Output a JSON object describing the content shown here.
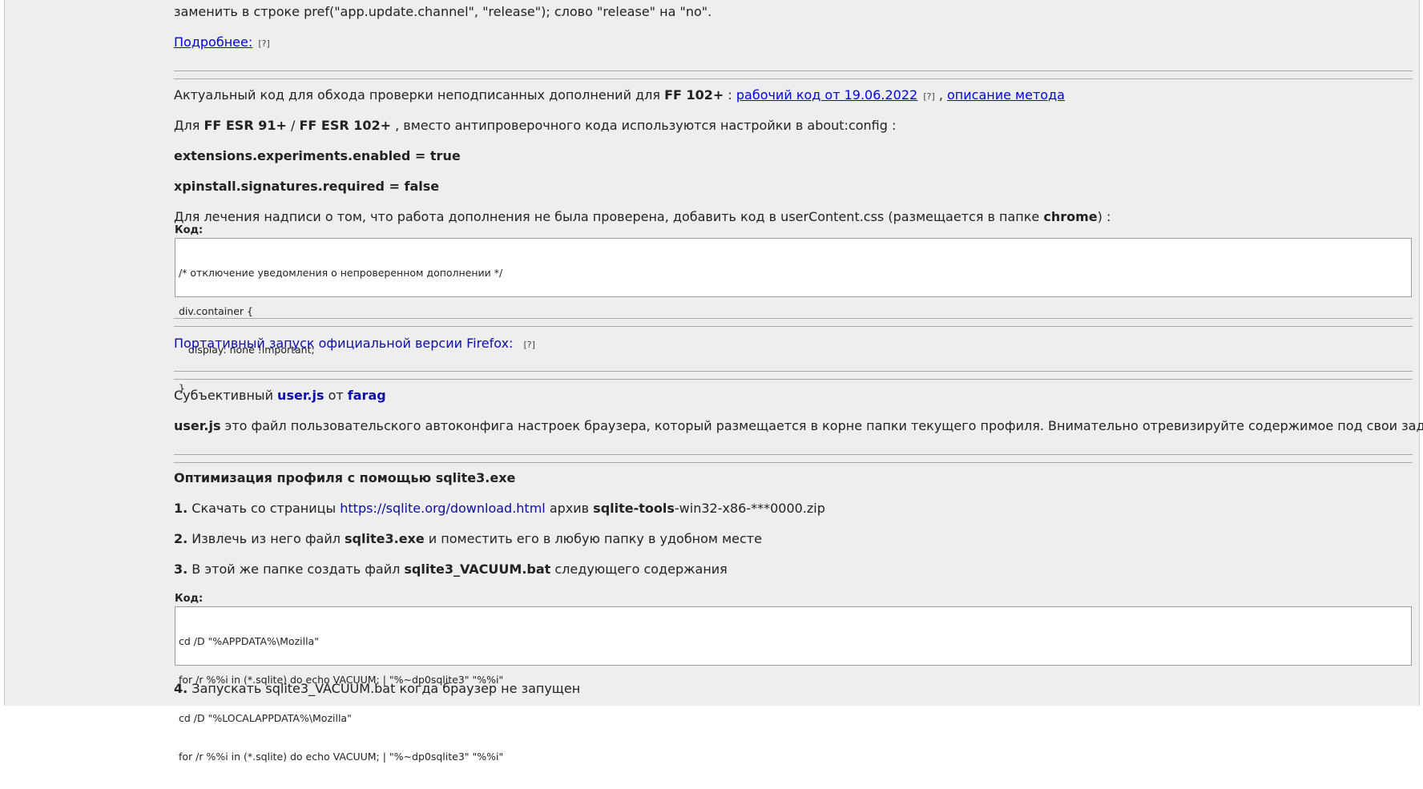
{
  "top_text": "заменить в строке pref(\"app.update.channel\", \"release\"); слово \"release\" на \"no\".",
  "more_link": "Подробнее:",
  "qmark": "[?]",
  "signed": {
    "prefix": "Актуальный код для обхода проверки неподписанных дополнений для ",
    "ff": "FF 102+",
    "colon": " : ",
    "code_link": "рабочий код от 19.06.2022",
    "comma": " , ",
    "method_link": "описание метода"
  },
  "esr": {
    "p1": "Для ",
    "b1": "FF ESR 91+",
    "slash": " / ",
    "b2": "FF ESR 102+",
    "p2": " , вместо антипроверочного кода используются настройки в about:config :"
  },
  "setting1": "extensions.experiments.enabled = true",
  "setting2": "xpinstall.signatures.required = false",
  "cure": {
    "p1": "Для лечения надписи о том, что работа дополнения не была проверена, добавить код в userContent.css (размещается в папке ",
    "b1": "chrome",
    "p2": ") :"
  },
  "code_label": "Код:",
  "code1": [
    "/* отключение уведомления о непроверенном дополнении */",
    "div.container {",
    "   display: none !important;",
    "}"
  ],
  "portable": "Портативный запуск официальной версии Firefox:",
  "userjs": {
    "p1": "Субъективный ",
    "b1": "user.js",
    "p2": " от ",
    "b2": "farag"
  },
  "userjs_desc": {
    "b1": "user.js",
    "p1": " это файл пользовательского автоконфига настроек браузера, который размещается в корне папки текущего профиля. Внимательно отревизируйте содержимое под свои задачи."
  },
  "sqlite_title": "Оптимизация профиля с помощью sqlite3.exe",
  "step1": {
    "n": "1.",
    "p1": " Скачать со страницы ",
    "link": "https://sqlite.org/download.html",
    "p2": " архив ",
    "b1": "sqlite-tools",
    "p3": "-win32-x86-***0000.zip"
  },
  "step2": {
    "n": "2.",
    "p1": " Извлечь из него файл ",
    "b1": "sqlite3.exe",
    "p2": " и поместить его в любую папку в удобном месте"
  },
  "step3": {
    "n": "3.",
    "p1": " В этой же папке создать файл ",
    "b1": "sqlite3_VACUUM.bat",
    "p2": " следующего содержания"
  },
  "code2": [
    "cd /D \"%APPDATA%\\Mozilla\"",
    "for /r %%i in (*.sqlite) do echo VACUUM; | \"%~dp0sqlite3\" \"%%i\"",
    "cd /D \"%LOCALAPPDATA%\\Mozilla\"",
    "for /r %%i in (*.sqlite) do echo VACUUM; | \"%~dp0sqlite3\" \"%%i\""
  ],
  "step4": {
    "n": "4.",
    "p1": " Запускать sqlite3_VACUUM.bat когда браузер не запущен"
  }
}
